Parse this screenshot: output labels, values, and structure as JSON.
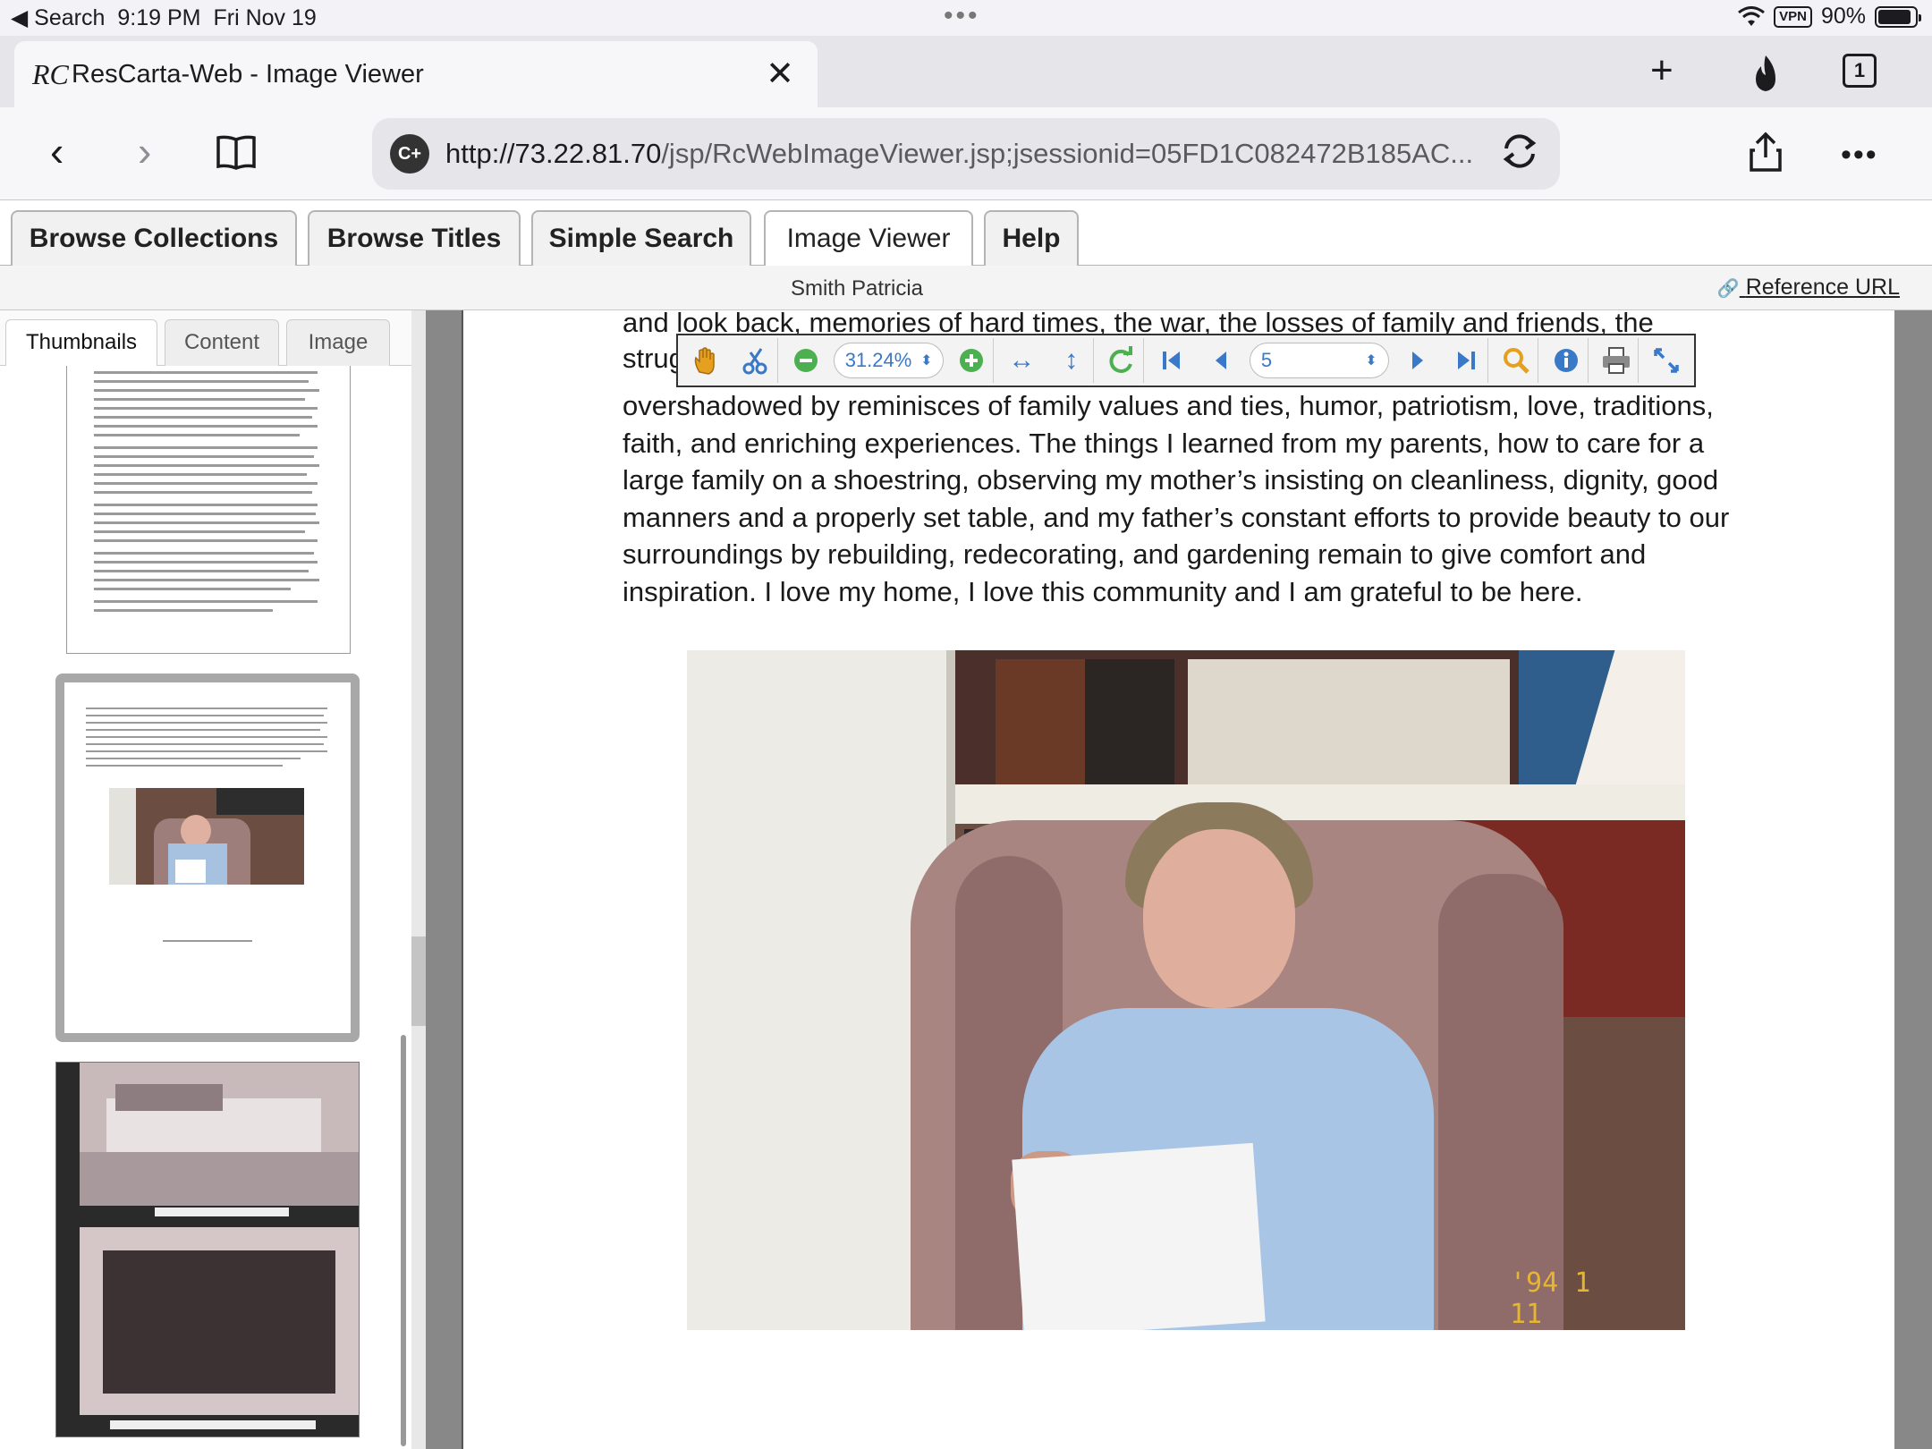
{
  "status": {
    "back_app": "Search",
    "time": "9:19 PM",
    "date": "Fri Nov 19",
    "vpn": "VPN",
    "battery": "90%",
    "battery_level": 0.9
  },
  "browser": {
    "tab_title": "ResCarta-Web - Image Viewer",
    "favicon": "RC",
    "tab_count": "1",
    "url_host": "http://73.22.81.70",
    "url_path": "/jsp/RcWebImageViewer.jsp;jsessionid=05FD1C082472B185AC...",
    "site_badge": "C+"
  },
  "site": {
    "nav_tabs": [
      "Browse Collections",
      "Browse Titles",
      "Simple Search",
      "Image Viewer",
      "Help"
    ],
    "active_tab": "Image Viewer",
    "document_title": "Smith Patricia",
    "reference_url": "Reference URL"
  },
  "side_panel": {
    "tabs": [
      "Thumbnails",
      "Content",
      "Image"
    ],
    "active_tab": "Thumbnails"
  },
  "viewer": {
    "zoom": "31.24%",
    "page": "5",
    "clipped_line": "and look back, memories of hard times, the war, the losses of family and friends, the",
    "clipped_partial": "strug",
    "paragraph": "overshadowed by reminisces of family values and ties, humor, patriotism, love, traditions, faith, and enriching experiences.  The things I learned from my parents, how to care for a large family on a shoestring, observing my mother’s insisting on cleanliness, dignity, good manners and a properly set table, and my father’s constant efforts to provide beauty to our surroundings by rebuilding, redecorating, and gardening remain to give comfort and inspiration.  I love my home, I love this community and I am grateful to be here.",
    "photo_stamp": "'94  1  11"
  }
}
